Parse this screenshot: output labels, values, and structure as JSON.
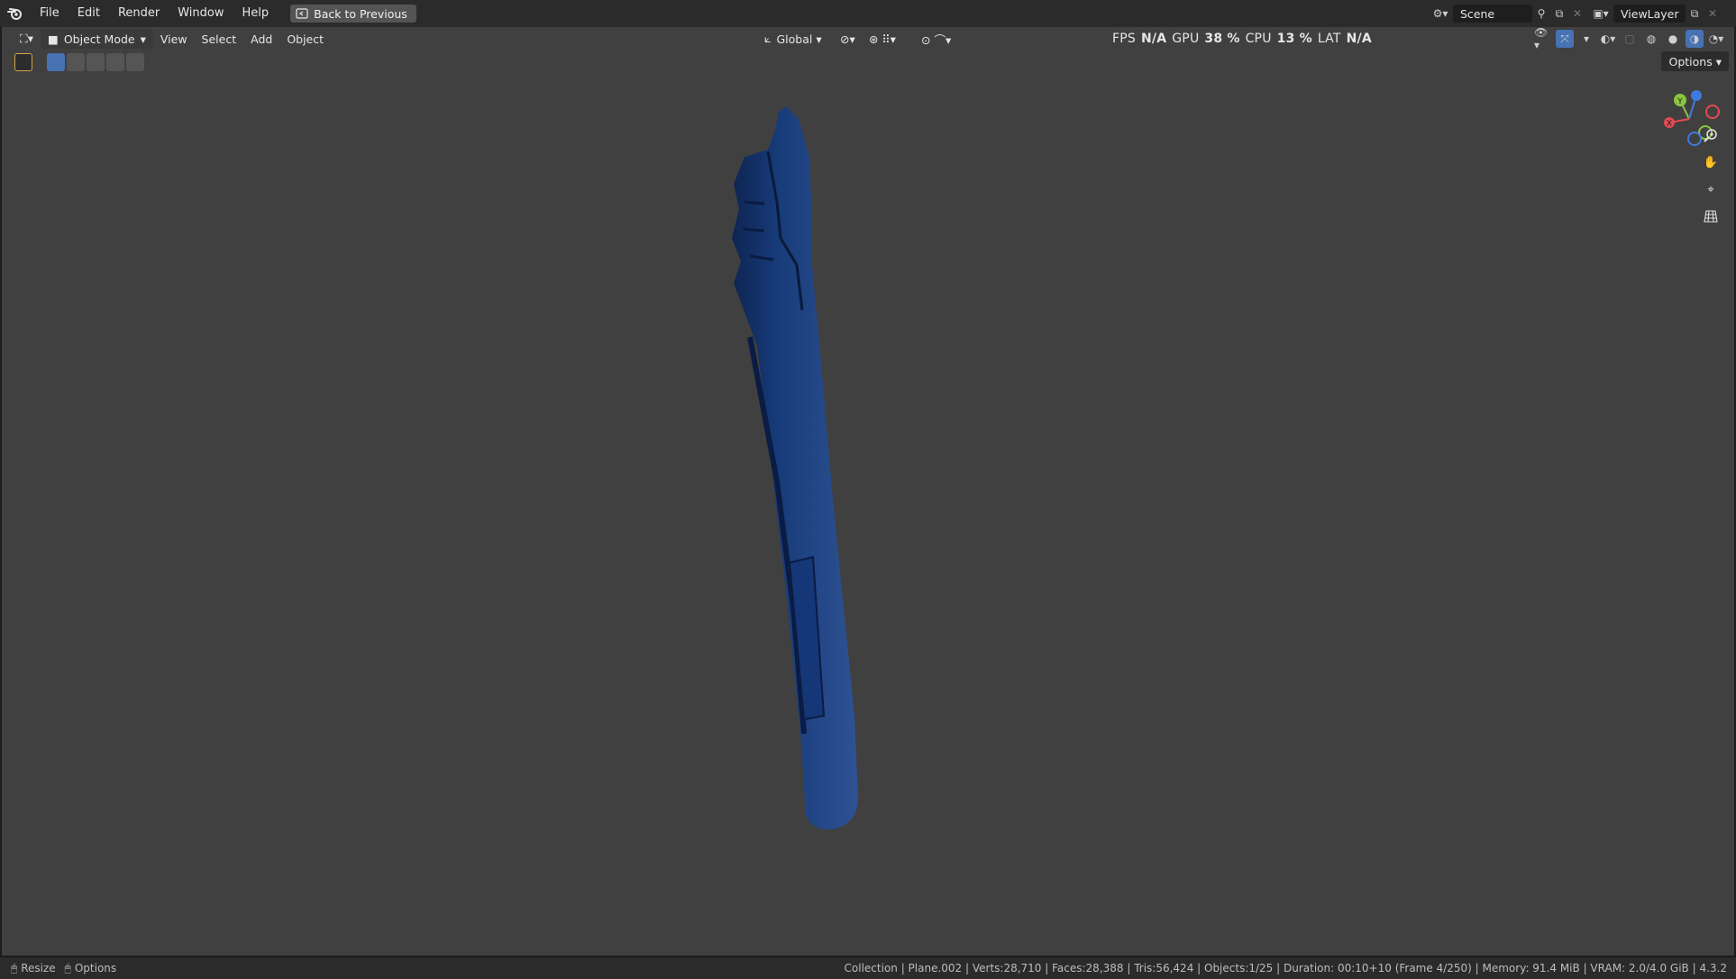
{
  "topbar": {
    "menu": [
      "File",
      "Edit",
      "Render",
      "Window",
      "Help"
    ],
    "back_button": "Back to Previous",
    "scene_name": "Scene",
    "view_layer": "ViewLayer"
  },
  "viewport_header": {
    "mode": "Object Mode",
    "menus": [
      "View",
      "Select",
      "Add",
      "Object"
    ],
    "transform_orientation": "Global",
    "options_label": "Options"
  },
  "perf": {
    "fps_label": "FPS",
    "fps_value": "N/A",
    "gpu_label": "GPU",
    "gpu_value": "38 %",
    "cpu_label": "CPU",
    "cpu_value": "13 %",
    "lat_label": "LAT",
    "lat_value": "N/A"
  },
  "gizmo": {
    "y_label": "Y",
    "x_label": "X",
    "colors": {
      "x": "#e34a52",
      "y": "#8bc53f",
      "z": "#3d7be0"
    }
  },
  "statusbar": {
    "left_items": [
      "Resize",
      "Options"
    ],
    "right_text": "Collection | Plane.002 | Verts:28,710 | Faces:28,388 | Tris:56,424 | Objects:1/25 | Duration: 00:10+10 (Frame 4/250) | Memory: 91.4 MiB | VRAM: 2.0/4.0 GiB | 4.3.2"
  },
  "colors": {
    "viewport_bg": "#404040",
    "model": "#1f3f7a",
    "accent": "#4772b3"
  }
}
